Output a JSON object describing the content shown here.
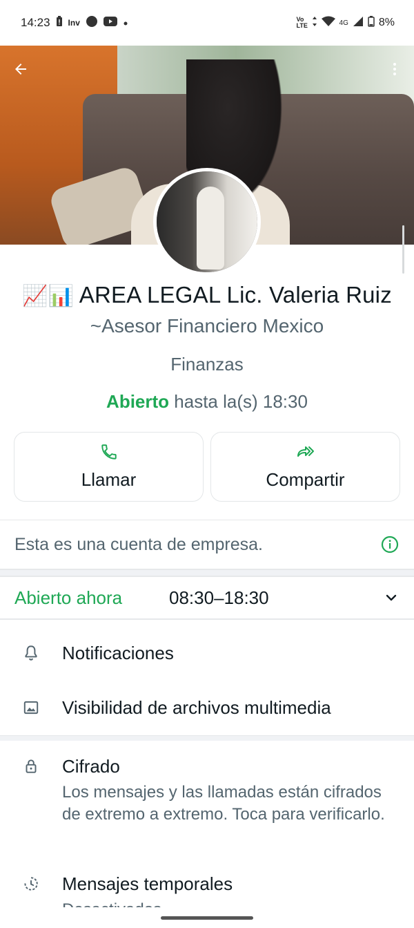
{
  "status_bar": {
    "time": "14:23",
    "left_icons": [
      "battery-alert-icon",
      "inv-icon",
      "circle-icon",
      "youtube-icon",
      "dot-icon"
    ],
    "inv_label": "Inv",
    "network": "4G",
    "volte": "Vo LTE",
    "battery": "8%"
  },
  "header": {
    "back_icon": "arrow-left-icon",
    "menu_icon": "more-vertical-icon"
  },
  "profile": {
    "name_emoji": "📈📊",
    "name": "AREA LEGAL Lic. Valeria Ruiz",
    "subtitle": "~Asesor Financiero Mexico",
    "category": "Finanzas",
    "status_open": "Abierto",
    "status_rest": " hasta la(s) 18:30"
  },
  "actions": [
    {
      "label": "Llamar",
      "icon": "phone-icon"
    },
    {
      "label": "Compartir",
      "icon": "forward-icon"
    }
  ],
  "business_notice": {
    "text": "Esta es una cuenta de empresa.",
    "icon": "info-icon"
  },
  "hours": {
    "open_now": "Abierto ahora",
    "range": "08:30–18:30",
    "icon": "chevron-down-icon"
  },
  "settings": [
    {
      "title": "Notificaciones",
      "icon": "bell-icon"
    },
    {
      "title": "Visibilidad de archivos multimedia",
      "icon": "image-icon"
    }
  ],
  "encryption": {
    "title": "Cifrado",
    "description": "Los mensajes y las llamadas están cifrados de extremo a extremo. Toca para verificarlo.",
    "icon": "lock-icon"
  },
  "temporary": {
    "title": "Mensajes temporales",
    "description": "Desactivados",
    "icon": "timer-icon"
  },
  "colors": {
    "accent": "#1fa855",
    "text_primary": "#111b21",
    "text_secondary": "#54656f"
  }
}
